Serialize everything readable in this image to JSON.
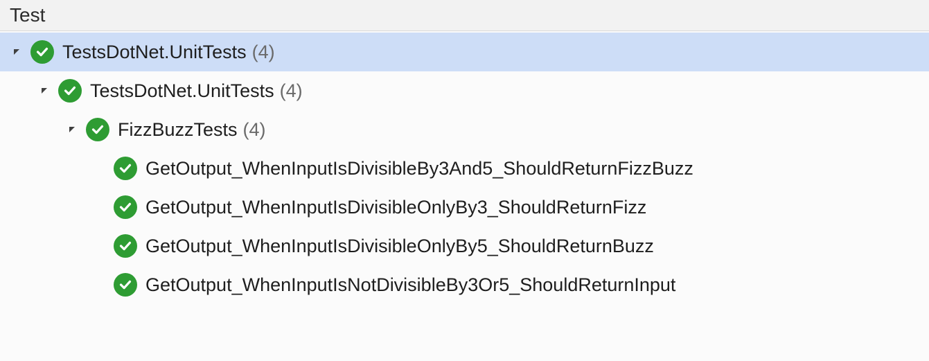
{
  "header": {
    "title": "Test"
  },
  "colors": {
    "pass": "#2e9c33",
    "selection": "#cdddf7"
  },
  "tree": {
    "root": {
      "label": "TestsDotNet.UnitTests",
      "count": "(4)",
      "status": "passed",
      "namespace": {
        "label": "TestsDotNet.UnitTests",
        "count": "(4)",
        "status": "passed",
        "class": {
          "label": "FizzBuzzTests",
          "count": "(4)",
          "status": "passed",
          "tests": [
            {
              "label": "GetOutput_WhenInputIsDivisibleBy3And5_ShouldReturnFizzBuzz",
              "status": "passed"
            },
            {
              "label": "GetOutput_WhenInputIsDivisibleOnlyBy3_ShouldReturnFizz",
              "status": "passed"
            },
            {
              "label": "GetOutput_WhenInputIsDivisibleOnlyBy5_ShouldReturnBuzz",
              "status": "passed"
            },
            {
              "label": "GetOutput_WhenInputIsNotDivisibleBy3Or5_ShouldReturnInput",
              "status": "passed"
            }
          ]
        }
      }
    }
  }
}
